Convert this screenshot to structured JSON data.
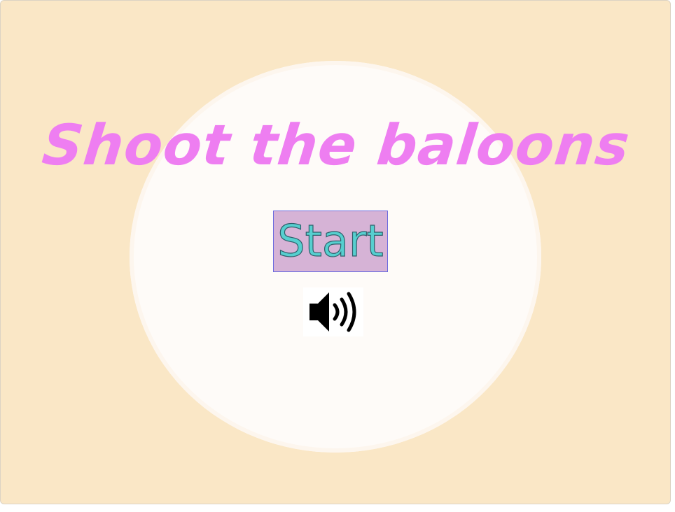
{
  "game": {
    "title": "Shoot the baloons",
    "start_label": "Start",
    "sound_icon": "speaker-volume-icon",
    "sound_state": "on"
  },
  "colors": {
    "background": "#fae7c6",
    "panel": "#fefbf8",
    "title": "#ee7ef1",
    "button_bg": "#d6b3d6",
    "button_text": "#56cfcf",
    "icon": "#000000"
  }
}
